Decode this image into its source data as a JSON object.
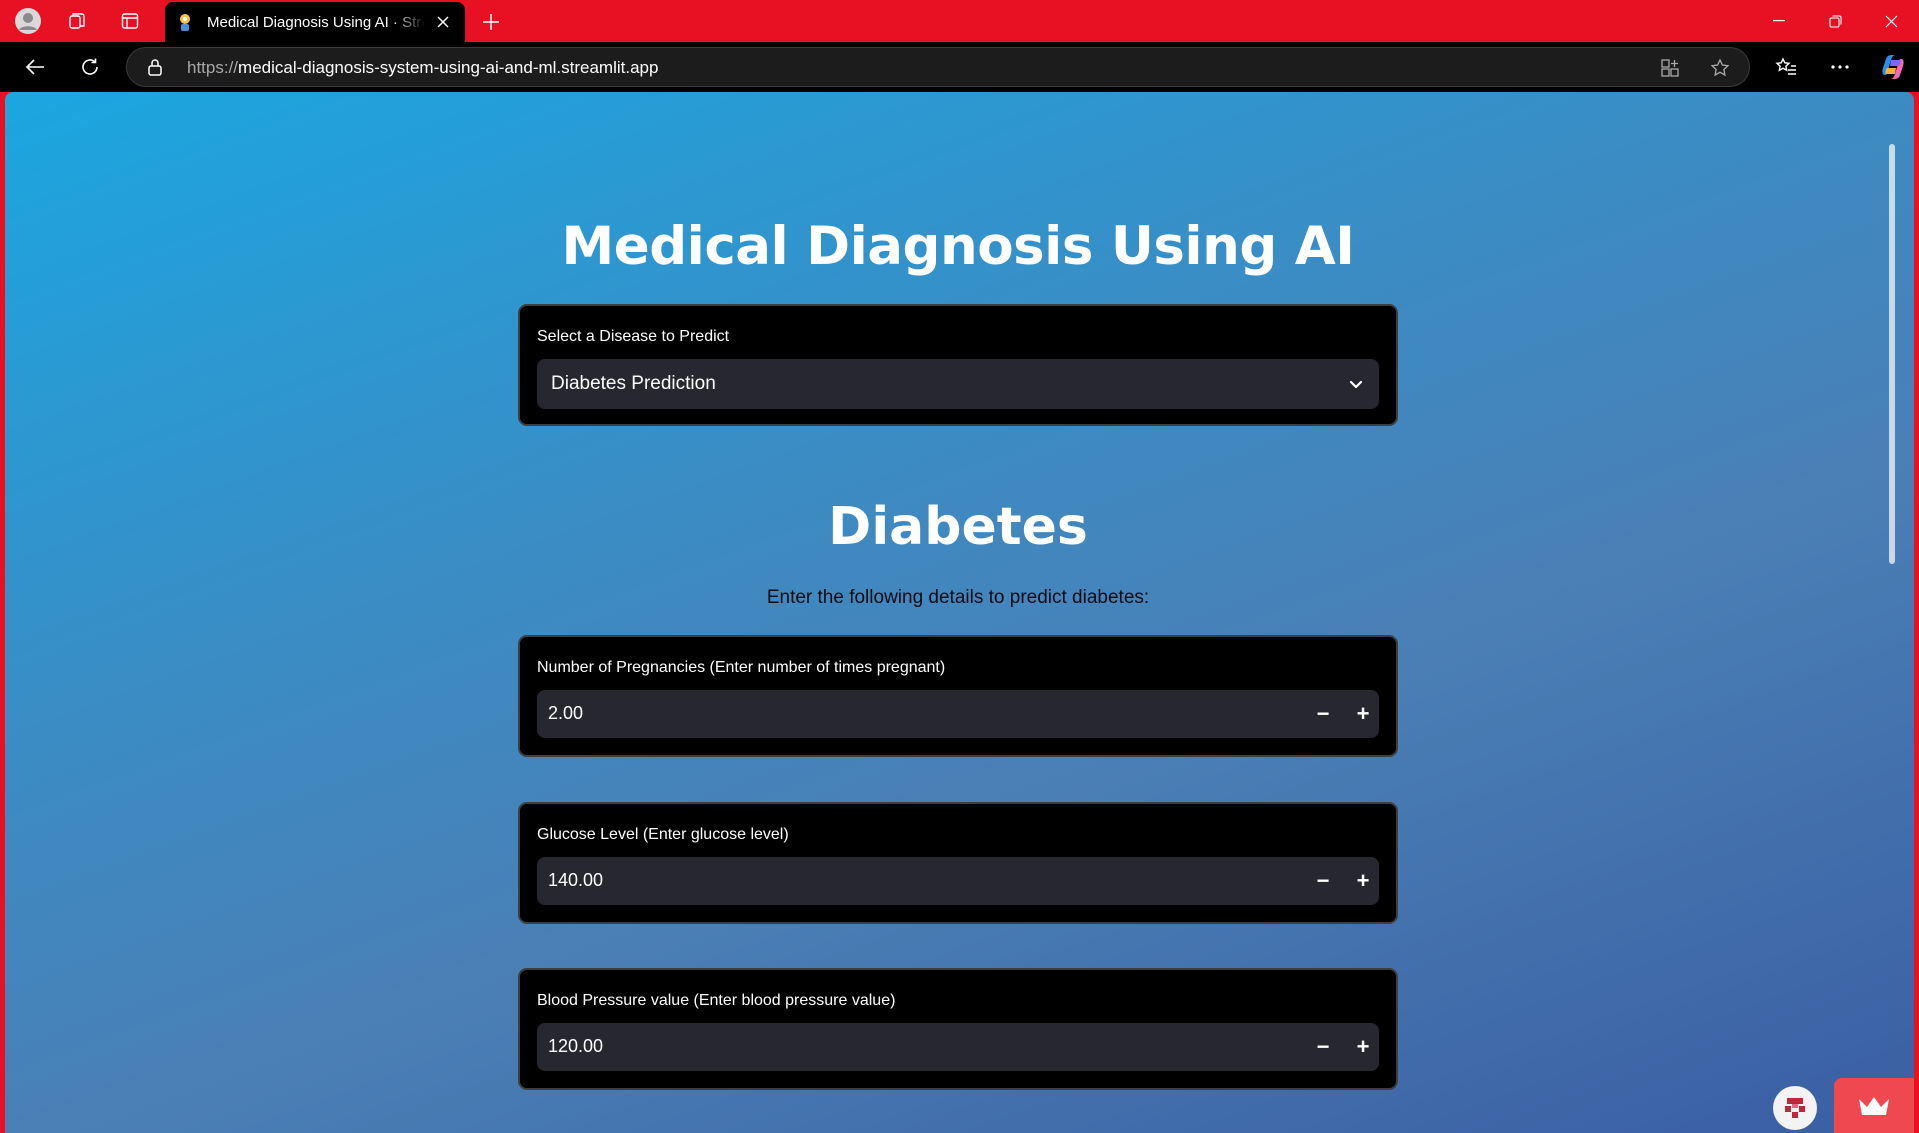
{
  "browser": {
    "tab_title": "Medical Diagnosis Using AI · Streamlit",
    "url_scheme": "https://",
    "url_host": "medical-diagnosis-system-using-ai-and-ml.streamlit.app",
    "accent_color": "#e81123"
  },
  "app": {
    "title": "Medical Diagnosis Using AI",
    "disease_select": {
      "label": "Select a Disease to Predict",
      "selected": "Diabetes Prediction"
    },
    "section": {
      "title": "Diabetes",
      "description": "Enter the following details to predict diabetes:"
    },
    "inputs": [
      {
        "label": "Number of Pregnancies (Enter number of times pregnant)",
        "value": "2.00",
        "minus": "−",
        "plus": "+"
      },
      {
        "label": "Glucose Level (Enter glucose level)",
        "value": "140.00",
        "minus": "−",
        "plus": "+"
      },
      {
        "label": "Blood Pressure value (Enter blood pressure value)",
        "value": "120.00",
        "minus": "−",
        "plus": "+"
      }
    ]
  }
}
